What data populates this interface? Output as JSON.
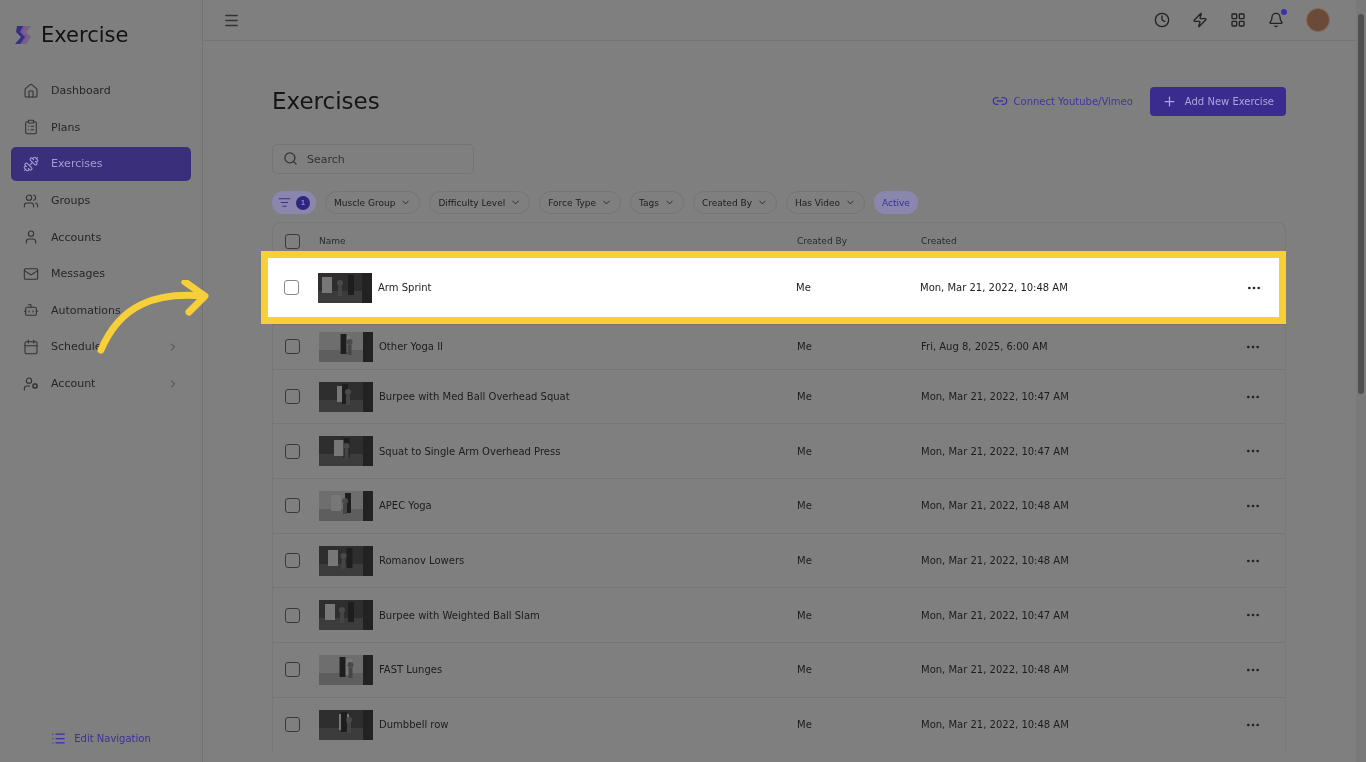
{
  "app": {
    "name": "Exercise"
  },
  "sidebar": {
    "items": [
      {
        "label": "Dashboard",
        "selected": false,
        "expandable": false
      },
      {
        "label": "Plans",
        "selected": false,
        "expandable": false
      },
      {
        "label": "Exercises",
        "selected": true,
        "expandable": false
      },
      {
        "label": "Groups",
        "selected": false,
        "expandable": false
      },
      {
        "label": "Accounts",
        "selected": false,
        "expandable": false
      },
      {
        "label": "Messages",
        "selected": false,
        "expandable": false
      },
      {
        "label": "Automations",
        "selected": false,
        "expandable": false
      },
      {
        "label": "Schedule",
        "selected": false,
        "expandable": true
      },
      {
        "label": "Account",
        "selected": false,
        "expandable": true
      }
    ],
    "footer": "Edit Navigation"
  },
  "topbar": {
    "notifications_unread": true
  },
  "page": {
    "title": "Exercises",
    "connect_link": "Connect Youtube/Vimeo",
    "add_button": "Add New Exercise"
  },
  "search": {
    "placeholder": "Search"
  },
  "filters": {
    "count": "1",
    "chips": [
      {
        "label": "Muscle Group",
        "kind": "dropdown"
      },
      {
        "label": "Difficulty Level",
        "kind": "dropdown"
      },
      {
        "label": "Force Type",
        "kind": "dropdown"
      },
      {
        "label": "Tags",
        "kind": "dropdown"
      },
      {
        "label": "Created By",
        "kind": "dropdown"
      },
      {
        "label": "Has Video",
        "kind": "dropdown"
      },
      {
        "label": "Active",
        "kind": "toggle"
      }
    ]
  },
  "table": {
    "columns": [
      "Name",
      "Created By",
      "Created"
    ],
    "all_checked": false,
    "rows": [
      {
        "name": "Arm Sprint",
        "created_by": "Me",
        "created": "Mon, Mar 21, 2022, 10:48 AM",
        "checked": false,
        "highlighted": true
      },
      {
        "name": "Other Yoga II",
        "created_by": "Me",
        "created": "Fri, Aug 8, 2025, 6:00 AM",
        "checked": false,
        "highlighted": false
      },
      {
        "name": "Burpee with Med Ball Overhead Squat",
        "created_by": "Me",
        "created": "Mon, Mar 21, 2022, 10:47 AM",
        "checked": false,
        "highlighted": false
      },
      {
        "name": "Squat to Single Arm Overhead Press",
        "created_by": "Me",
        "created": "Mon, Mar 21, 2022, 10:47 AM",
        "checked": false,
        "highlighted": false
      },
      {
        "name": "APEC Yoga",
        "created_by": "Me",
        "created": "Mon, Mar 21, 2022, 10:48 AM",
        "checked": false,
        "highlighted": false
      },
      {
        "name": "Romanov Lowers",
        "created_by": "Me",
        "created": "Mon, Mar 21, 2022, 10:48 AM",
        "checked": false,
        "highlighted": false
      },
      {
        "name": "Burpee with Weighted Ball Slam",
        "created_by": "Me",
        "created": "Mon, Mar 21, 2022, 10:47 AM",
        "checked": false,
        "highlighted": false
      },
      {
        "name": "FAST Lunges",
        "created_by": "Me",
        "created": "Mon, Mar 21, 2022, 10:48 AM",
        "checked": false,
        "highlighted": false
      },
      {
        "name": "Dumbbell row",
        "created_by": "Me",
        "created": "Mon, Mar 21, 2022, 10:48 AM",
        "checked": false,
        "highlighted": false
      }
    ]
  }
}
